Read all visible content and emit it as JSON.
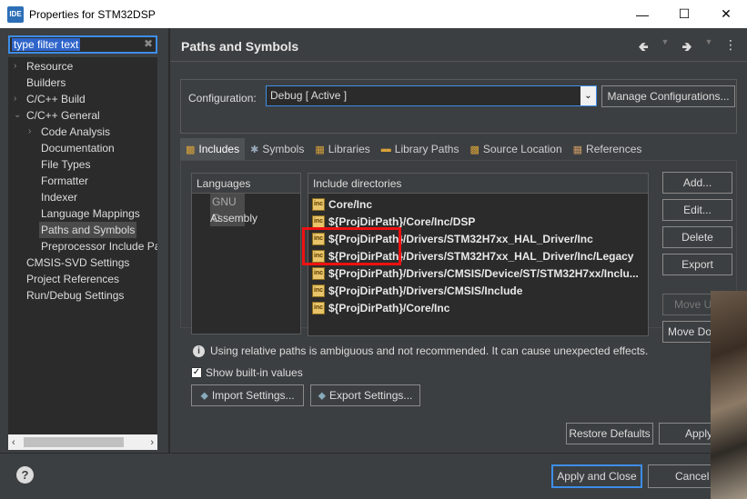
{
  "window": {
    "icon_text": "IDE",
    "title": "Properties for STM32DSP"
  },
  "filter": {
    "text": "type filter text"
  },
  "tree": [
    {
      "label": "Resource",
      "arrow": "›"
    },
    {
      "label": "Builders",
      "arrow": ""
    },
    {
      "label": "C/C++ Build",
      "arrow": "›"
    },
    {
      "label": "C/C++ General",
      "arrow": "⌄"
    },
    {
      "label": "Code Analysis",
      "arrow": "›"
    },
    {
      "label": "Documentation",
      "arrow": ""
    },
    {
      "label": "File Types",
      "arrow": ""
    },
    {
      "label": "Formatter",
      "arrow": ""
    },
    {
      "label": "Indexer",
      "arrow": ""
    },
    {
      "label": "Language Mappings",
      "arrow": ""
    },
    {
      "label": "Paths and Symbols",
      "arrow": ""
    },
    {
      "label": "Preprocessor Include Pat",
      "arrow": ""
    },
    {
      "label": "CMSIS-SVD Settings",
      "arrow": ""
    },
    {
      "label": "Project References",
      "arrow": ""
    },
    {
      "label": "Run/Debug Settings",
      "arrow": ""
    }
  ],
  "page": {
    "title": "Paths and Symbols"
  },
  "config": {
    "label": "Configuration:",
    "value": "Debug  [ Active ]",
    "manage_label": "Manage Configurations..."
  },
  "tabs": [
    {
      "label": "Includes",
      "icon": "includes-icon"
    },
    {
      "label": "Symbols",
      "icon": "symbols-icon"
    },
    {
      "label": "Libraries",
      "icon": "libraries-icon"
    },
    {
      "label": "Library Paths",
      "icon": "library-paths-icon"
    },
    {
      "label": "Source Location",
      "icon": "source-location-icon"
    },
    {
      "label": "References",
      "icon": "references-icon"
    }
  ],
  "languages": {
    "header": "Languages",
    "items": [
      "GNU C",
      "Assembly"
    ]
  },
  "includes": {
    "header": "Include directories",
    "items": [
      "Core/Inc",
      "${ProjDirPath}/Core/Inc/DSP",
      "${ProjDirPath}/Drivers/STM32H7xx_HAL_Driver/Inc",
      "${ProjDirPath}/Drivers/STM32H7xx_HAL_Driver/Inc/Legacy",
      "${ProjDirPath}/Drivers/CMSIS/Device/ST/STM32H7xx/Inclu...",
      "${ProjDirPath}/Drivers/CMSIS/Include",
      "${ProjDirPath}/Core/Inc"
    ]
  },
  "side_buttons": {
    "add": "Add...",
    "edit": "Edit...",
    "delete": "Delete",
    "export": "Export",
    "move_up": "Move Up",
    "move_down": "Move Down"
  },
  "info": "Using relative paths is ambiguous and not recommended. It can cause unexpected effects.",
  "show_builtin": {
    "label": "Show built-in values",
    "checked": true
  },
  "import_label": "Import Settings...",
  "export_label": "Export Settings...",
  "restore_label": "Restore Defaults",
  "apply_label": "Apply",
  "apply_close_label": "Apply and Close",
  "cancel_label": "Cancel"
}
